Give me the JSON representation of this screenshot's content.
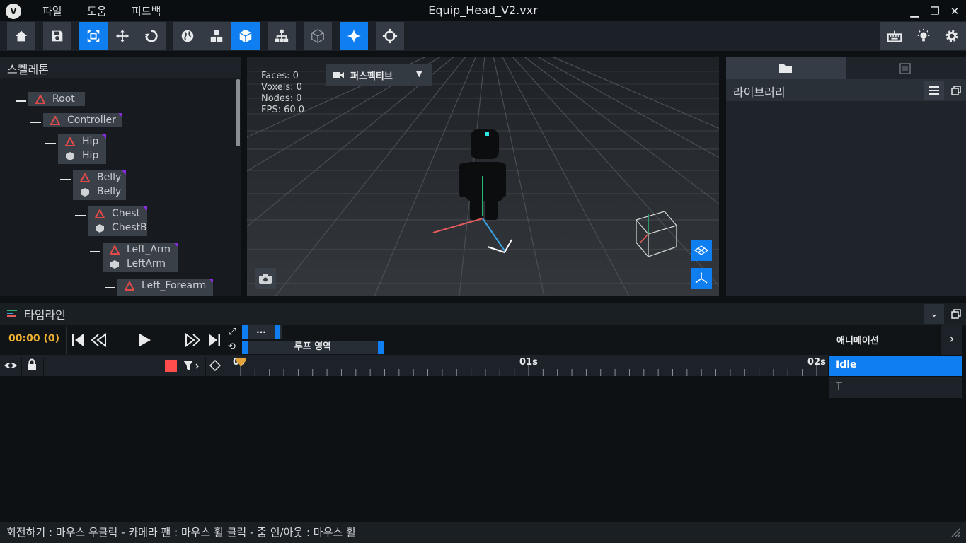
{
  "window": {
    "title": "Equip_Head_V2.vxr",
    "menu": [
      "파일",
      "도움",
      "피드백"
    ],
    "controls": [
      "minimize",
      "restore",
      "close"
    ]
  },
  "toolbar": {
    "buttons": [
      {
        "icon": "home-icon",
        "active": false
      },
      {
        "icon": "save-icon",
        "active": false
      },
      {
        "icon": "select-scale-icon",
        "active": true
      },
      {
        "icon": "move-icon",
        "active": false
      },
      {
        "icon": "rotate-icon",
        "active": false
      },
      {
        "icon": "world-icon",
        "active": false
      },
      {
        "icon": "voxels-icon",
        "active": false
      },
      {
        "icon": "cube-icon",
        "active": true
      },
      {
        "icon": "hierarchy-icon",
        "active": false
      },
      {
        "icon": "wireframe-cube-icon",
        "active": false
      },
      {
        "icon": "sparkle-icon",
        "active": true
      },
      {
        "icon": "crosshair-icon",
        "active": false
      },
      {
        "icon": "keyboard-icon",
        "active": false
      },
      {
        "icon": "light-icon",
        "active": false
      },
      {
        "icon": "settings-icon",
        "active": false
      }
    ],
    "accent_color": "#0f7ef0"
  },
  "skeleton": {
    "title": "스켈레톤",
    "nodes": [
      {
        "bone": "Root",
        "mesh": ""
      },
      {
        "bone": "Controller",
        "mesh": ""
      },
      {
        "bone": "Hip",
        "mesh": "Hip"
      },
      {
        "bone": "Belly",
        "mesh": "Belly"
      },
      {
        "bone": "Chest",
        "mesh": "ChestB"
      },
      {
        "bone": "Left_Arm",
        "mesh": "LeftArm"
      },
      {
        "bone": "Left_Forearm",
        "mesh": ""
      }
    ]
  },
  "viewport": {
    "stats": {
      "faces": "Faces: 0",
      "voxels": "Voxels: 0",
      "nodes": "Nodes: 0",
      "fps": "FPS: 60.0"
    },
    "camera_mode": "퍼스펙티브"
  },
  "library": {
    "title": "라이브러리",
    "tabs": [
      "folder-icon",
      "frame-icon"
    ]
  },
  "timeline": {
    "title": "타임라인",
    "timecode": "00:00 (0)",
    "loop_label": "루프 영역",
    "more": "···",
    "ruler_labels": [
      "0s",
      "01s",
      "02s"
    ],
    "animation_header": "애니메이션",
    "animations": [
      {
        "name": "Idle",
        "selected": true
      },
      {
        "name": "T",
        "selected": false
      }
    ],
    "playhead_color": "#e3a33a",
    "record_color": "#ff4d4d"
  },
  "status": {
    "text": "회전하기 : 마우스 우클릭 - 카메라 팬 : 마우스 휠 클릭 - 줌 인/아웃 : 마우스 휠"
  }
}
